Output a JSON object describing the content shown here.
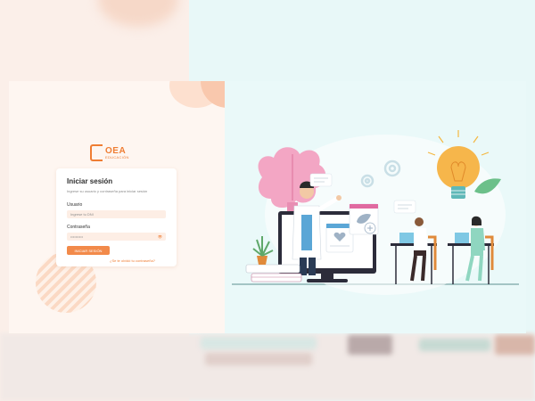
{
  "brand": {
    "name": "OEA",
    "tagline": "EDUCACIÓN",
    "accent": "#ef7d33"
  },
  "login": {
    "title": "Iniciar sesión",
    "subtitle": "Ingrese su usuario y contraseña para iniciar sesión",
    "username_label": "Usuario",
    "username_placeholder": "Ingrese tu DNI",
    "password_label": "Contraseña",
    "password_value": "••••••••••",
    "password_toggle_icon": "eye-icon",
    "submit_label": "INICIAR SESIÓN",
    "forgot_label": "¿Se te olvidó tu contraseña?"
  },
  "colors": {
    "left_bg": "#fef6f1",
    "right_bg": "#eaf9f9",
    "button": "#f28a4a",
    "input_bg": "#fdeee5"
  },
  "illustration": {
    "description_icons": [
      "brain-icon",
      "lightbulb-icon",
      "gear-icon",
      "laptop-icon",
      "books-icon",
      "plant-icon"
    ]
  }
}
